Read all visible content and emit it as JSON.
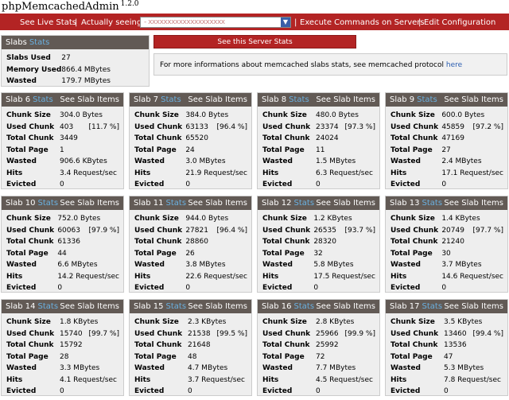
{
  "app": {
    "title": "phpMemcachedAdmin",
    "version": "1.2.0"
  },
  "topbar": {
    "see_live": "See Live Stats",
    "actually_seeing": "Actually seeing",
    "server_value": "- xxxxxxxxxxxxxxxxxxxx",
    "execute": "Execute Commands on Servers",
    "edit": "Edit Configuration",
    "sep": "|"
  },
  "slabs_summary": {
    "header": "Slabs",
    "header_accent": "Stats",
    "rows": [
      {
        "label": "Slabs Used",
        "value": "27"
      },
      {
        "label": "Memory Used",
        "value": "866.4 MBytes"
      },
      {
        "label": "Wasted",
        "value": "179.7 MBytes"
      }
    ]
  },
  "server_stats_button": "See this Server Stats",
  "info": {
    "text": "For more informations about memcached slabs stats, see memcached protocol ",
    "link": "here"
  },
  "labels": {
    "chunk_size": "Chunk Size",
    "used_chunk": "Used Chunk",
    "total_chunk": "Total Chunk",
    "total_page": "Total Page",
    "wasted": "Wasted",
    "hits": "Hits",
    "evicted": "Evicted",
    "stats": "Stats",
    "see_items": "See Slab Items"
  },
  "slabs": [
    {
      "name": "Slab 6",
      "chunk_size": "304.0 Bytes",
      "used_chunk": "403",
      "used_pct": "[11.7 %]",
      "total_chunk": "3449",
      "total_page": "1",
      "wasted": "906.6 KBytes",
      "hits": "3.4 Request/sec",
      "evicted": "0"
    },
    {
      "name": "Slab 7",
      "chunk_size": "384.0 Bytes",
      "used_chunk": "63133",
      "used_pct": "[96.4 %]",
      "total_chunk": "65520",
      "total_page": "24",
      "wasted": "3.0 MBytes",
      "hits": "21.9 Request/sec",
      "evicted": "0"
    },
    {
      "name": "Slab 8",
      "chunk_size": "480.0 Bytes",
      "used_chunk": "23374",
      "used_pct": "[97.3 %]",
      "total_chunk": "24024",
      "total_page": "11",
      "wasted": "1.5 MBytes",
      "hits": "6.3 Request/sec",
      "evicted": "0"
    },
    {
      "name": "Slab 9",
      "chunk_size": "600.0 Bytes",
      "used_chunk": "45859",
      "used_pct": "[97.2 %]",
      "total_chunk": "47169",
      "total_page": "27",
      "wasted": "2.4 MBytes",
      "hits": "17.1 Request/sec",
      "evicted": "0"
    },
    {
      "name": "Slab 10",
      "chunk_size": "752.0 Bytes",
      "used_chunk": "60063",
      "used_pct": "[97.9 %]",
      "total_chunk": "61336",
      "total_page": "44",
      "wasted": "6.6 MBytes",
      "hits": "14.2 Request/sec",
      "evicted": "0"
    },
    {
      "name": "Slab 11",
      "chunk_size": "944.0 Bytes",
      "used_chunk": "27821",
      "used_pct": "[96.4 %]",
      "total_chunk": "28860",
      "total_page": "26",
      "wasted": "3.8 MBytes",
      "hits": "22.6 Request/sec",
      "evicted": "0"
    },
    {
      "name": "Slab 12",
      "chunk_size": "1.2 KBytes",
      "used_chunk": "26535",
      "used_pct": "[93.7 %]",
      "total_chunk": "28320",
      "total_page": "32",
      "wasted": "5.8 MBytes",
      "hits": "17.5 Request/sec",
      "evicted": "0"
    },
    {
      "name": "Slab 13",
      "chunk_size": "1.4 KBytes",
      "used_chunk": "20749",
      "used_pct": "[97.7 %]",
      "total_chunk": "21240",
      "total_page": "30",
      "wasted": "3.7 MBytes",
      "hits": "14.6 Request/sec",
      "evicted": "0"
    },
    {
      "name": "Slab 14",
      "chunk_size": "1.8 KBytes",
      "used_chunk": "15740",
      "used_pct": "[99.7 %]",
      "total_chunk": "15792",
      "total_page": "28",
      "wasted": "3.3 MBytes",
      "hits": "4.1 Request/sec",
      "evicted": "0"
    },
    {
      "name": "Slab 15",
      "chunk_size": "2.3 KBytes",
      "used_chunk": "21538",
      "used_pct": "[99.5 %]",
      "total_chunk": "21648",
      "total_page": "48",
      "wasted": "4.7 MBytes",
      "hits": "3.7 Request/sec",
      "evicted": "0"
    },
    {
      "name": "Slab 16",
      "chunk_size": "2.8 KBytes",
      "used_chunk": "25966",
      "used_pct": "[99.9 %]",
      "total_chunk": "25992",
      "total_page": "72",
      "wasted": "7.7 MBytes",
      "hits": "4.5 Request/sec",
      "evicted": "0"
    },
    {
      "name": "Slab 17",
      "chunk_size": "3.5 KBytes",
      "used_chunk": "13460",
      "used_pct": "[99.4 %]",
      "total_chunk": "13536",
      "total_page": "47",
      "wasted": "5.3 MBytes",
      "hits": "7.8 Request/sec",
      "evicted": "0"
    }
  ]
}
